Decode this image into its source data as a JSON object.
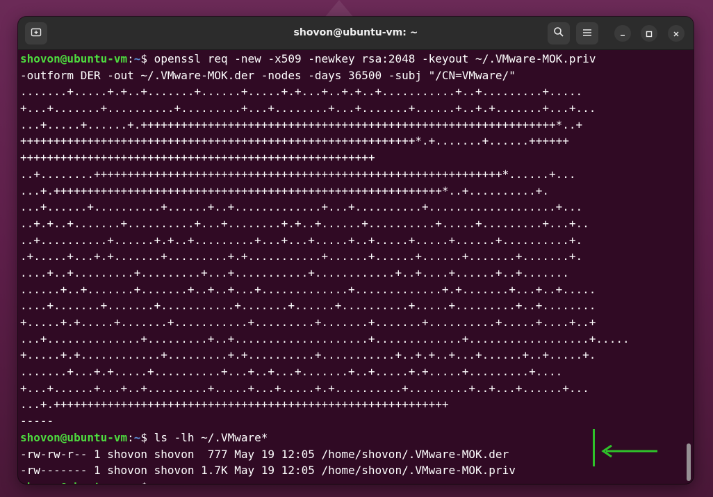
{
  "window": {
    "title": "shovon@ubuntu-vm: ~",
    "new_tab_icon": "new-tab-icon",
    "search_icon": "search-icon",
    "menu_icon": "hamburger-menu-icon",
    "minimize_icon": "minimize-icon",
    "maximize_icon": "maximize-icon",
    "close_icon": "close-icon"
  },
  "prompt": {
    "user_host": "shovon@ubuntu-vm",
    "colon": ":",
    "path": "~",
    "dollar": "$"
  },
  "colors": {
    "user_host": "#4edb3f",
    "path": "#5b8fd8",
    "background": "#300a24",
    "annotation": "#2fc22a"
  },
  "terminal": {
    "cmd1_l1": " openssl req -new -x509 -newkey rsa:2048 -keyout ~/.VMware-MOK.priv",
    "cmd1_l2": "-outform DER -out ~/.VMware-MOK.der -nodes -days 36500 -subj \"/CN=VMware/\"",
    "keygen": [
      ".......+.....+.+..+.......+......+.....+.+...+..+.+..+...........+..+.........+.....",
      "+...+.......+..........+.........+...+........+...+.......+......+..+.+.......+...+...",
      "...+.....+......+.++++++++++++++++++++++++++++++++++++++++++++++++++++++++++++++*..+",
      "+++++++++++++++++++++++++++++++++++++++++++++++++++++++++++*.+.......+......++++++",
      "+++++++++++++++++++++++++++++++++++++++++++++++++++++",
      "..+........+++++++++++++++++++++++++++++++++++++++++++++++++++++++++++++*......+...",
      "...+.++++++++++++++++++++++++++++++++++++++++++++++++++++++++++*..+..........+.",
      "...+......+..........+......+..+.............+...+..........+...................+...",
      "..+.+..+.......+..........+...+........+.+..+......+..........+.....+.........+...+..",
      "..+..........+......+.+..+.........+...+...+.....+..+.....+.....+......+..........+.",
      ".+.....+...+.+.......+.........+.+...........+......+......+......+.......+.......+.",
      "....+..+.........+.........+...+...........+............+..+....+......+..+.......",
      "......+..+.......+.......+..+..+...+.............+.............+.+.......+...+..+.....",
      "....+.......+.......+...........+.......+......+..........+.....+.........+..+........",
      "+.....+.+.....+.......+...........+.........+.......+.......+..........+.....+....+..+",
      "...+..............+.........+..+....................+.............+..................+.....",
      "+.....+.+............+.........+.+..........+...........+..+.+..+...+......+..+.....+.",
      ".......+...+.+.....+..........+...+..+...+.......+..+.....+.+.....+.........+....",
      "+...+......+...+..+.........+.....+...+.....+.+..........+.........+..+...+......+...",
      "...+.+++++++++++++++++++++++++++++++++++++++++++++++++++++++++++",
      "-----"
    ],
    "cmd2": " ls -lh ~/.VMware*",
    "out1": "-rw-rw-r-- 1 shovon shovon  777 May 19 12:05 /home/shovon/.VMware-MOK.der",
    "out2": "-rw------- 1 shovon shovon 1.7K May 19 12:05 /home/shovon/.VMware-MOK.priv"
  }
}
